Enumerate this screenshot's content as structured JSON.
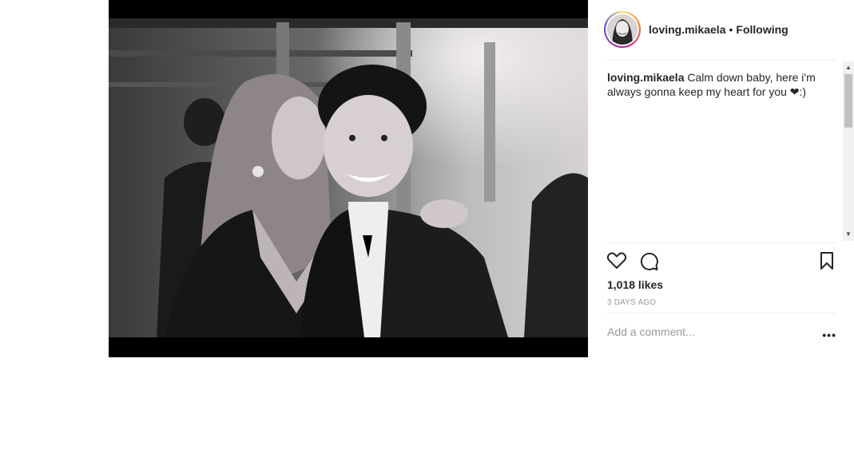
{
  "post": {
    "username": "loving.mikaela",
    "separator": "•",
    "follow_status": "Following",
    "caption_user": "loving.mikaela",
    "caption_text": " Calm down baby, here i'm always gonna keep my heart for you ❤:)",
    "likes": "1,018 likes",
    "date": "3 DAYS AGO",
    "comment_placeholder": "Add a comment...",
    "more_label": "•••"
  },
  "icons": {
    "like": "heart-icon",
    "comment": "comment-bubble-icon",
    "save": "bookmark-icon",
    "more": "more-options-icon"
  },
  "colors": {
    "text": "#262626",
    "muted": "#999999",
    "divider": "#efefef"
  }
}
